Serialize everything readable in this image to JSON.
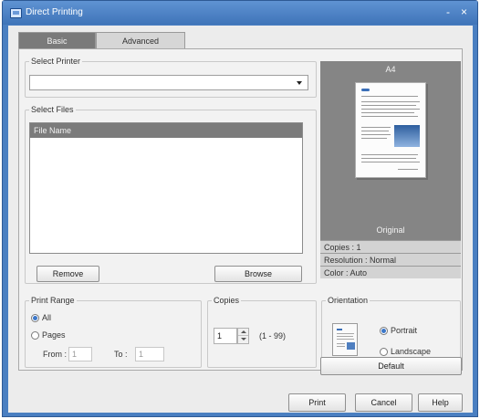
{
  "window": {
    "title": "Direct Printing",
    "minimize_glyph": "-",
    "close_glyph": "×"
  },
  "tabs": [
    {
      "label": "Basic",
      "active": true
    },
    {
      "label": "Advanced",
      "active": false
    }
  ],
  "select_printer": {
    "label": "Select Printer",
    "value": ""
  },
  "select_files": {
    "label": "Select Files",
    "column_header": "File Name",
    "files": []
  },
  "buttons": {
    "remove": "Remove",
    "browse": "Browse",
    "default": "Default",
    "print": "Print",
    "cancel": "Cancel",
    "help": "Help"
  },
  "print_range": {
    "label": "Print Range",
    "options": [
      "All",
      "Pages"
    ],
    "selected": "All",
    "from_label": "From :",
    "from_value": "1",
    "to_label": "To :",
    "to_value": "1"
  },
  "copies": {
    "label": "Copies",
    "value": "1",
    "range": "(1 - 99)"
  },
  "orientation": {
    "label": "Orientation",
    "options": [
      "Portrait",
      "Landscape"
    ],
    "selected": "Portrait"
  },
  "preview": {
    "header": "A4",
    "caption": "Original",
    "info": [
      "Copies : 1",
      "Resolution : Normal",
      "Color : Auto"
    ]
  },
  "colors": {
    "title_bar": "#4a7fc1",
    "active_tab": "#7a7a7a",
    "preview_bg": "#858585",
    "accent": "#3d78c9"
  },
  "icons": {
    "app": "printer-window-icon",
    "dropdown": "chevron-down-icon",
    "spin": "spin-arrows-icon"
  }
}
